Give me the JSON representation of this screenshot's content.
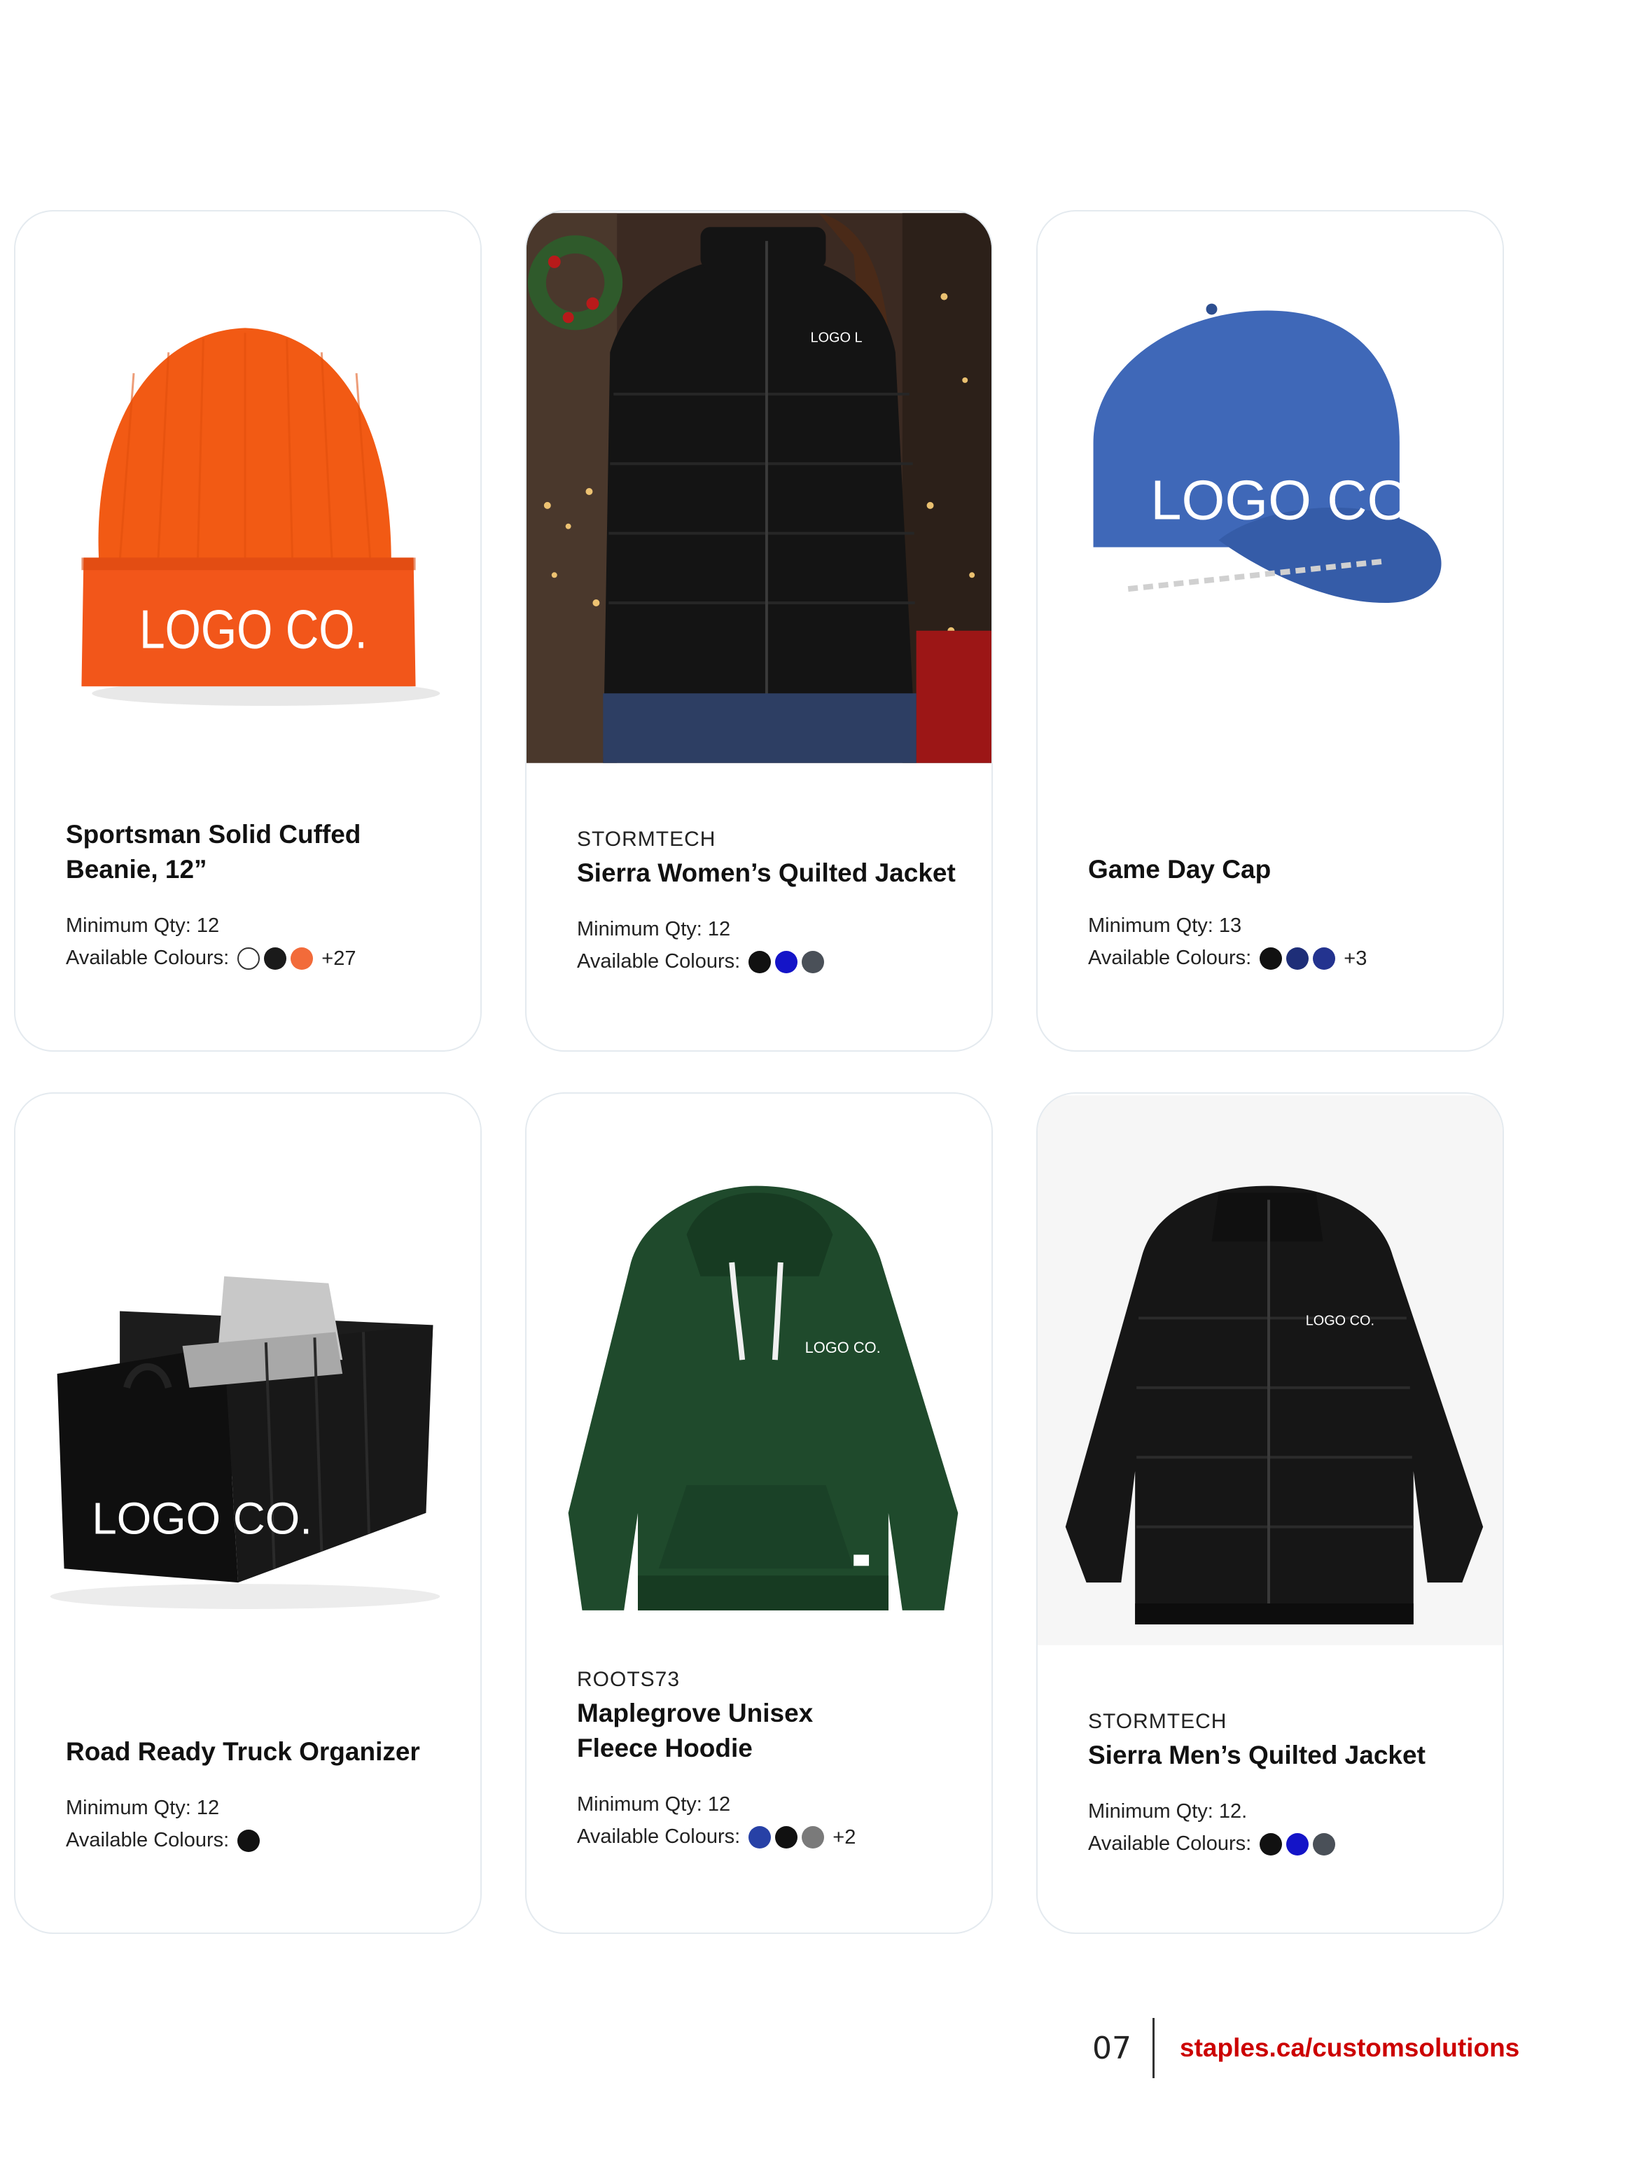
{
  "products": [
    {
      "brand": "",
      "title": "Sportsman Solid Cuffed Beanie, 12”",
      "min_qty_label": "Minimum Qty: 12",
      "colours_label": "Available Colours:",
      "swatches": [
        "#ffffff",
        "#1a1a1a",
        "#f26b3a"
      ],
      "more": "+27",
      "image_text": "LOGO CO."
    },
    {
      "brand": "STORMTECH",
      "title": "Sierra Women’s Quilted Jacket",
      "min_qty_label": "Minimum Qty: 12",
      "colours_label": "Available Colours:",
      "swatches": [
        "#111111",
        "#1414c8",
        "#4a5058"
      ],
      "more": "",
      "image_text": "LOGO L"
    },
    {
      "brand": "",
      "title": "Game Day Cap",
      "min_qty_label": "Minimum Qty: 13",
      "colours_label": "Available Colours:",
      "swatches": [
        "#111111",
        "#1e2e78",
        "#23338f"
      ],
      "more": "+3",
      "image_text": "LOGO CO."
    },
    {
      "brand": "",
      "title": "Road Ready Truck Organizer",
      "min_qty_label": "Minimum Qty: 12",
      "colours_label": "Available Colours:",
      "swatches": [
        "#111111"
      ],
      "more": "",
      "image_text": "LOGO CO."
    },
    {
      "brand": "ROOTS73",
      "title": "Maplegrove Unisex Fleece Hoodie",
      "min_qty_label": "Minimum Qty: 12",
      "colours_label": "Available Colours:",
      "swatches": [
        "#2741a6",
        "#111111",
        "#7a7a7a"
      ],
      "more": "+2",
      "image_text": "LOGO CO."
    },
    {
      "brand": "STORMTECH",
      "title": "Sierra Men’s Quilted Jacket",
      "min_qty_label": "Minimum Qty: 12.",
      "colours_label": "Available Colours:",
      "swatches": [
        "#111111",
        "#1414c8",
        "#4a5058"
      ],
      "more": "",
      "image_text": "LOGO CO."
    }
  ],
  "footer": {
    "page_number": "07",
    "url": "staples.ca/customsolutions",
    "url_color": "#cc0000"
  }
}
